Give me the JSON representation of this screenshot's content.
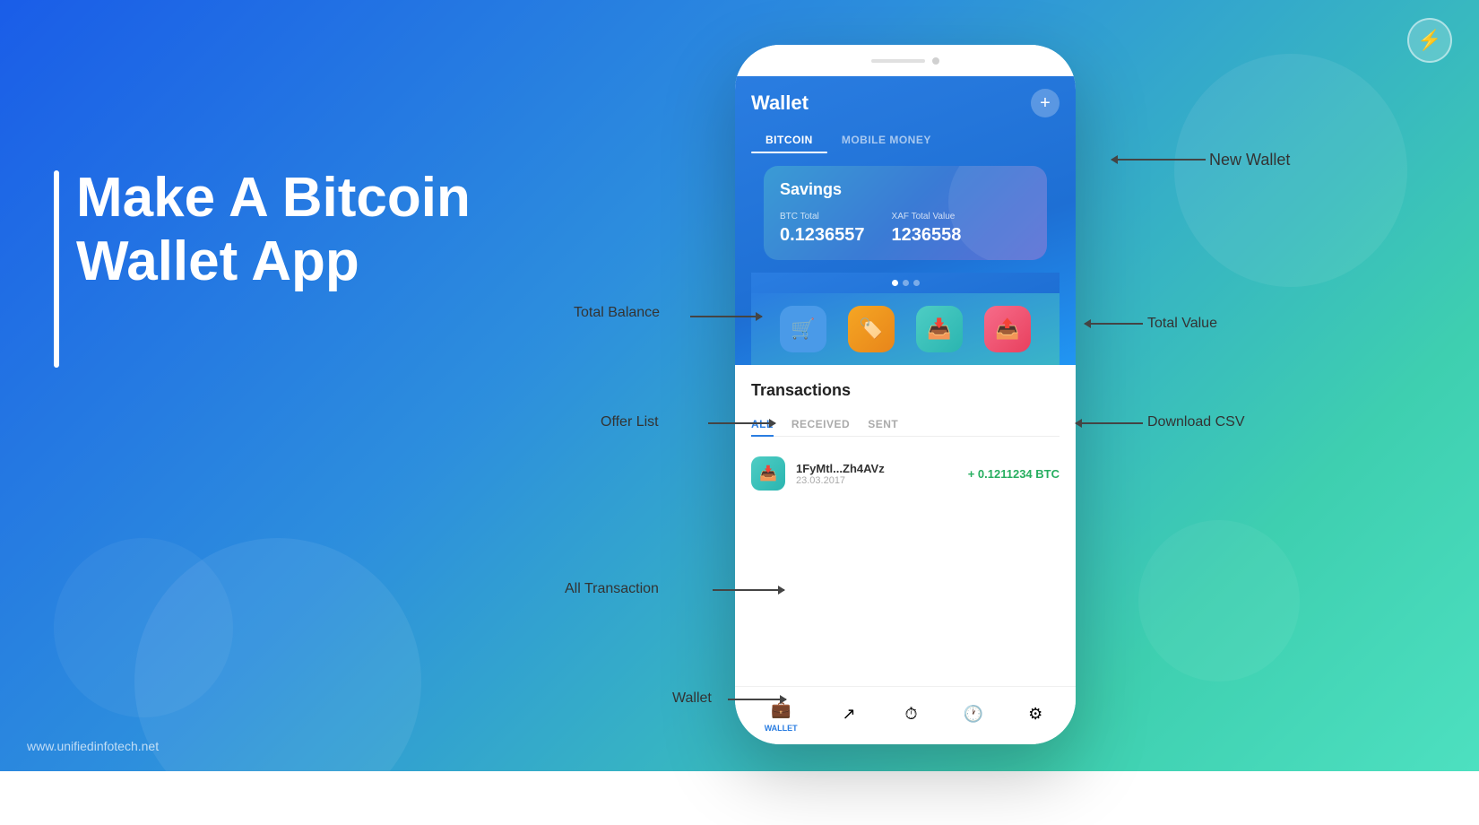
{
  "background": {
    "gradient_start": "#1a5de8",
    "gradient_end": "#4de0c0"
  },
  "logo": {
    "symbol": "⚡"
  },
  "headline": {
    "line1": "Make A Bitcoin",
    "line2": "Wallet App"
  },
  "website": "www.unifiedinfotech.net",
  "phone": {
    "header": {
      "title": "Wallet",
      "plus_label": "+"
    },
    "tabs": [
      {
        "label": "BITCOIN",
        "active": true
      },
      {
        "label": "MOBILE MONEY",
        "active": false
      }
    ],
    "savings_card": {
      "label": "Savings",
      "btc_label": "BTC Total",
      "btc_value": "0.1236557",
      "xaf_label": "XAF Total Value",
      "xaf_value": "1236558"
    },
    "action_buttons": [
      {
        "icon": "🛒",
        "color": "blue",
        "name": "offer-list"
      },
      {
        "icon": "🏷️",
        "color": "orange",
        "name": "tag"
      },
      {
        "icon": "📥",
        "color": "teal",
        "name": "download-csv"
      },
      {
        "icon": "📤",
        "color": "pink",
        "name": "share"
      }
    ],
    "transactions": {
      "title": "Transactions",
      "tabs": [
        {
          "label": "ALL",
          "active": true
        },
        {
          "label": "RECEIVED",
          "active": false
        },
        {
          "label": "SENT",
          "active": false
        }
      ],
      "items": [
        {
          "address": "1FyMtl...Zh4AVz",
          "date": "23.03.2017",
          "amount": "+ 0.1211234 BTC",
          "type": "received"
        }
      ]
    },
    "bottom_nav": [
      {
        "icon": "💼",
        "label": "WALLET",
        "active": true
      },
      {
        "icon": "↗",
        "label": "",
        "active": false
      },
      {
        "icon": "⏱",
        "label": "",
        "active": false
      },
      {
        "icon": "🕐",
        "label": "",
        "active": false
      },
      {
        "icon": "⚙",
        "label": "",
        "active": false
      }
    ]
  },
  "annotations": {
    "total_balance": "Total Balance",
    "total_value": "Total Value",
    "offer_list": "Offer List",
    "download_csv": "Download CSV",
    "all_transaction": "All Transaction",
    "wallet": "Wallet",
    "new_wallet": "New Wallet"
  }
}
